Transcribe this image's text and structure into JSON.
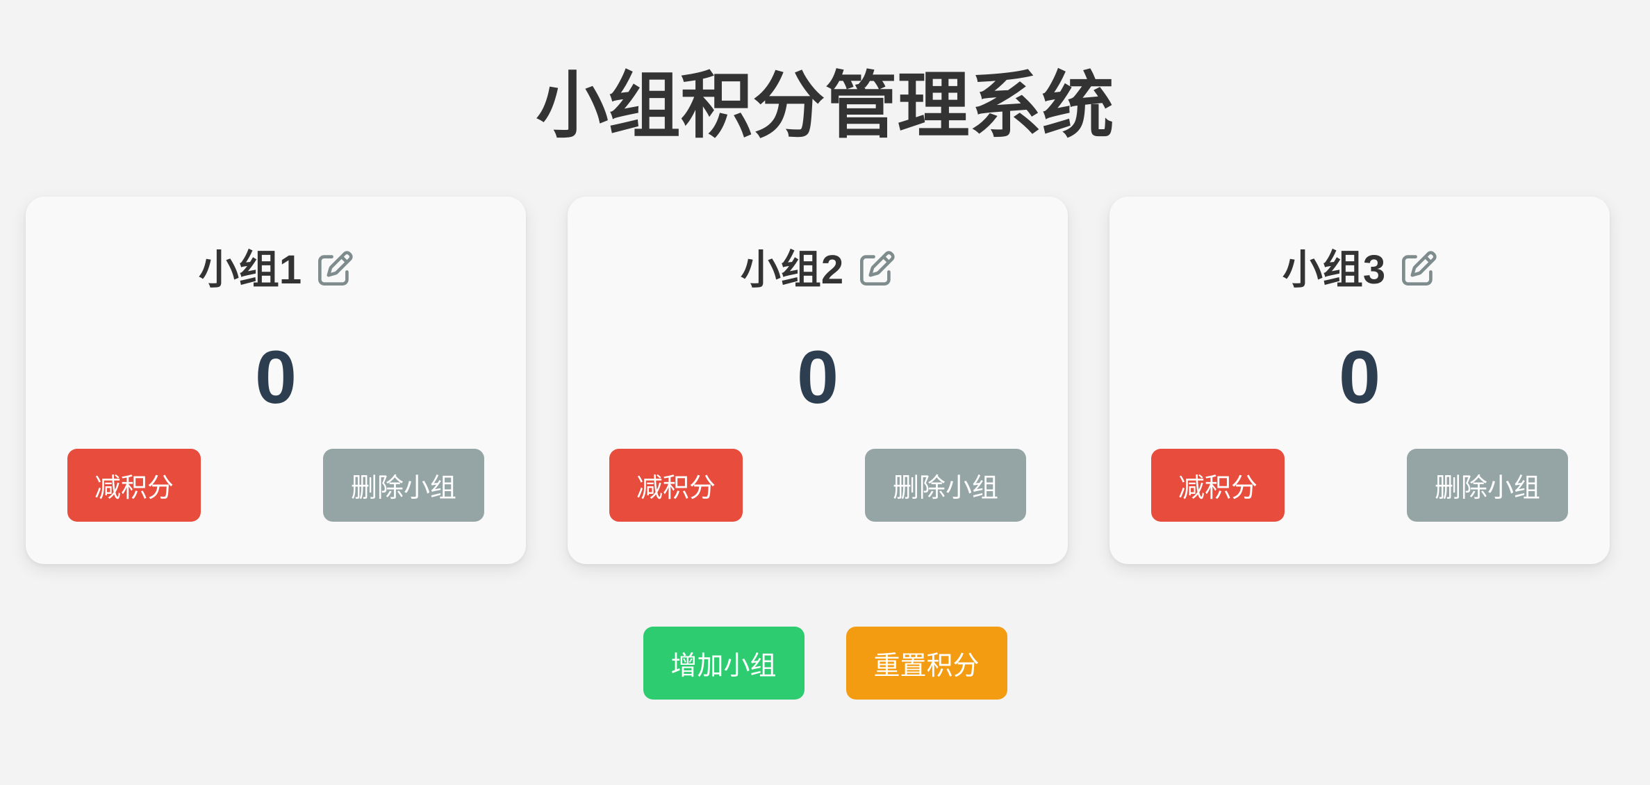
{
  "page": {
    "title": "小组积分管理系统"
  },
  "groups": [
    {
      "name": "小组1",
      "score": "0",
      "minus_label": "减积分",
      "delete_label": "删除小组"
    },
    {
      "name": "小组2",
      "score": "0",
      "minus_label": "减积分",
      "delete_label": "删除小组"
    },
    {
      "name": "小组3",
      "score": "0",
      "minus_label": "减积分",
      "delete_label": "删除小组"
    }
  ],
  "actions": {
    "add_label": "增加小组",
    "reset_label": "重置积分"
  },
  "icons": {
    "edit": "edit-icon"
  },
  "colors": {
    "title": "#333333",
    "score": "#2c3e50",
    "minus": "#e74c3c",
    "delete": "#95a5a6",
    "add": "#2ecc71",
    "reset": "#f39c12",
    "icon": "#7f8c8d"
  }
}
